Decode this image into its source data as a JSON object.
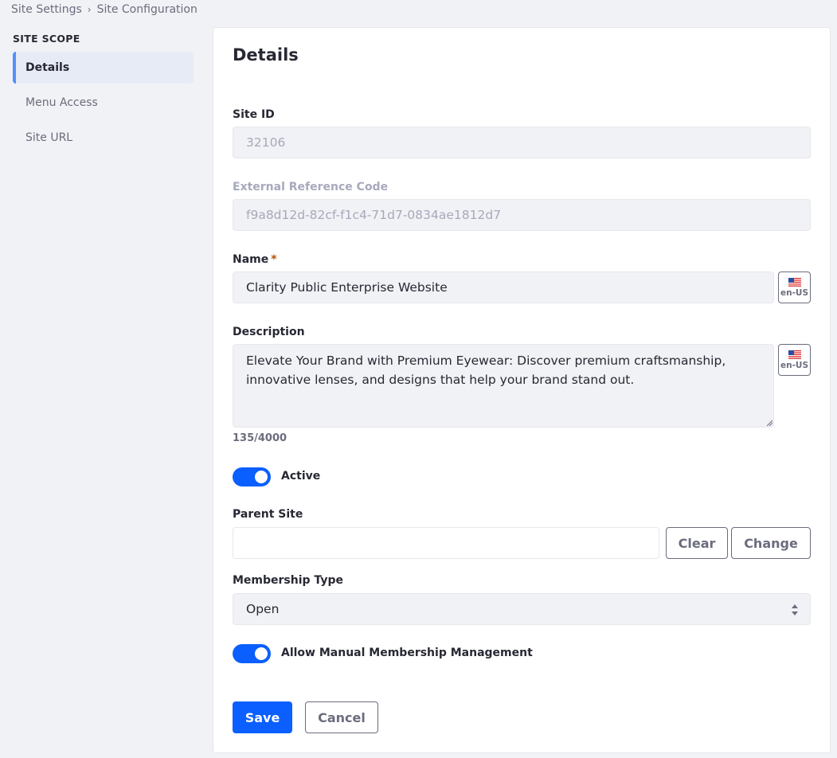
{
  "breadcrumb": {
    "items": [
      "Site Settings",
      "Site Configuration"
    ],
    "separator": "›"
  },
  "sidebar": {
    "section_title": "SITE SCOPE",
    "items": [
      {
        "label": "Details",
        "active": true
      },
      {
        "label": "Menu Access",
        "active": false
      },
      {
        "label": "Site URL",
        "active": false
      }
    ]
  },
  "form": {
    "title": "Details",
    "site_id": {
      "label": "Site ID",
      "value": "32106"
    },
    "external_reference_code": {
      "label": "External Reference Code",
      "value": "f9a8d12d-82cf-f1c4-71d7-0834ae1812d7"
    },
    "name": {
      "label": "Name",
      "required_mark": "*",
      "value": "Clarity Public Enterprise Website",
      "locale": "en-US"
    },
    "description": {
      "label": "Description",
      "value": "Elevate Your Brand with Premium Eyewear: Discover premium craftsmanship, innovative lenses, and designs that help your brand stand out.",
      "locale": "en-US",
      "counter": "135/4000"
    },
    "active": {
      "label": "Active",
      "on": true
    },
    "parent_site": {
      "label": "Parent Site",
      "value": "",
      "clear_label": "Clear",
      "change_label": "Change"
    },
    "membership_type": {
      "label": "Membership Type",
      "value": "Open"
    },
    "manual_membership": {
      "label": "Allow Manual Membership Management",
      "on": true
    },
    "save_label": "Save",
    "cancel_label": "Cancel"
  },
  "colors": {
    "primary": "#0b5fff",
    "active_accent": "#528fff",
    "active_bg": "#e6ebf5",
    "required": "#b95000",
    "page_bg": "#f1f2f5"
  },
  "icons": {
    "breadcrumb_separator": "chevron-right-icon",
    "locale_flag": "us-flag-icon",
    "select_caret": "caret-double-icon"
  }
}
